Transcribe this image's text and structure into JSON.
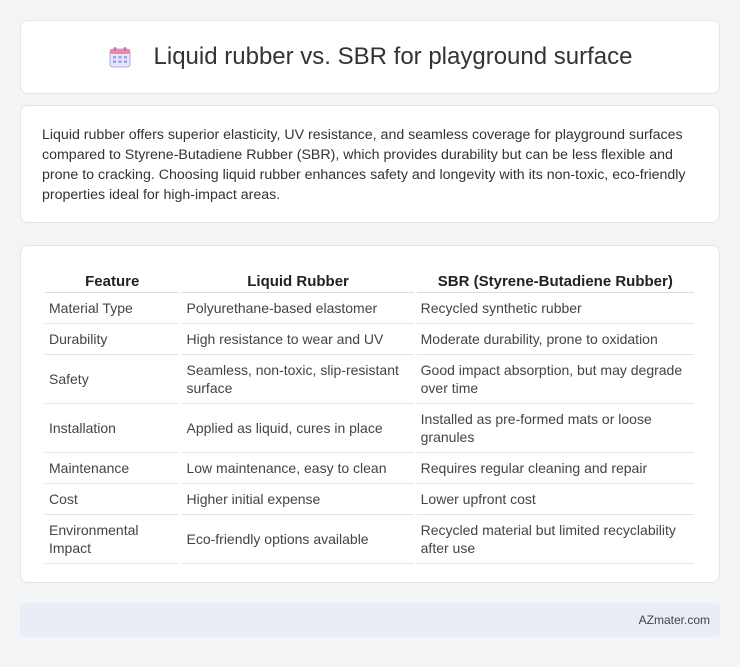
{
  "header": {
    "title": "Liquid rubber vs. SBR for playground surface",
    "icon": "calendar-icon"
  },
  "summary": {
    "text": "Liquid rubber offers superior elasticity, UV resistance, and seamless coverage for playground surfaces compared to Styrene-Butadiene Rubber (SBR), which provides durability but can be less flexible and prone to cracking. Choosing liquid rubber enhances safety and longevity with its non-toxic, eco-friendly properties ideal for high-impact areas."
  },
  "table": {
    "headers": [
      "Feature",
      "Liquid Rubber",
      "SBR (Styrene-Butadiene Rubber)"
    ],
    "rows": [
      [
        "Material Type",
        "Polyurethane-based elastomer",
        "Recycled synthetic rubber"
      ],
      [
        "Durability",
        "High resistance to wear and UV",
        "Moderate durability, prone to oxidation"
      ],
      [
        "Safety",
        "Seamless, non-toxic, slip-resistant surface",
        "Good impact absorption, but may degrade over time"
      ],
      [
        "Installation",
        "Applied as liquid, cures in place",
        "Installed as pre-formed mats or loose granules"
      ],
      [
        "Maintenance",
        "Low maintenance, easy to clean",
        "Requires regular cleaning and repair"
      ],
      [
        "Cost",
        "Higher initial expense",
        "Lower upfront cost"
      ],
      [
        "Environmental Impact",
        "Eco-friendly options available",
        "Recycled material but limited recyclability after use"
      ]
    ]
  },
  "footer": {
    "brand": "AZmater.com"
  },
  "colors": {
    "accent": "#7b7fe0",
    "background": "#f3f4f6",
    "footer_bg": "#e9edf5"
  }
}
